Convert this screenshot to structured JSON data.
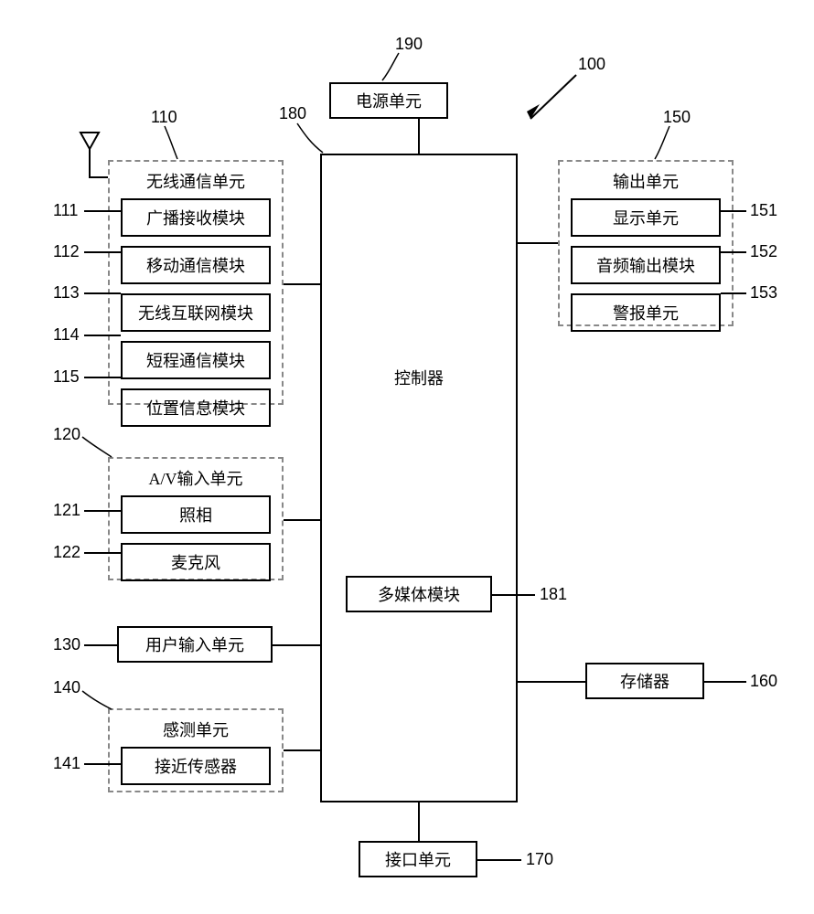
{
  "refs": {
    "r100": "100",
    "r110": "110",
    "r111": "111",
    "r112": "112",
    "r113": "113",
    "r114": "114",
    "r115": "115",
    "r120": "120",
    "r121": "121",
    "r122": "122",
    "r130": "130",
    "r140": "140",
    "r141": "141",
    "r150": "150",
    "r151": "151",
    "r152": "152",
    "r153": "153",
    "r160": "160",
    "r170": "170",
    "r180": "180",
    "r181": "181",
    "r190": "190"
  },
  "blocks": {
    "power": "电源单元",
    "controller": "控制器",
    "multimedia": "多媒体模块",
    "interface": "接口单元",
    "userInput": "用户输入单元",
    "memory": "存储器",
    "wireless": {
      "title": "无线通信单元",
      "items": [
        "广播接收模块",
        "移动通信模块",
        "无线互联网模块",
        "短程通信模块",
        "位置信息模块"
      ]
    },
    "avInput": {
      "title": "A/V输入单元",
      "items": [
        "照相",
        "麦克风"
      ]
    },
    "sensing": {
      "title": "感测单元",
      "items": [
        "接近传感器"
      ]
    },
    "output": {
      "title": "输出单元",
      "items": [
        "显示单元",
        "音频输出模块",
        "警报单元"
      ]
    }
  }
}
